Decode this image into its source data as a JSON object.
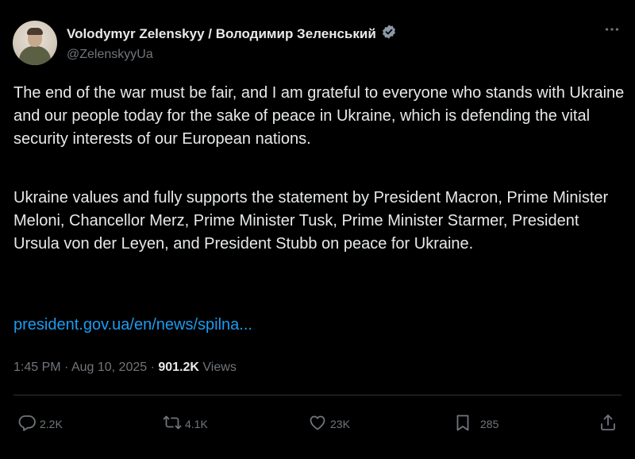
{
  "post": {
    "author_name": "Volodymyr Zelenskyy / Володимир Зеленський",
    "handle": "@ZelenskyyUa",
    "verified": true,
    "paragraph1": "The end of the war must be fair, and I am grateful to everyone who stands with Ukraine and our people today for the sake of peace in Ukraine, which is defending the vital security interests of our European nations.",
    "paragraph2": "Ukraine values and fully supports the statement by President Macron, Prime Minister Meloni, Chancellor Merz, Prime Minister Tusk, Prime Minister Starmer, President Ursula von der Leyen, and President Stubb on peace for Ukraine.",
    "link_text": "president.gov.ua/en/news/spilna...",
    "time": "1:45 PM",
    "date": "Aug 10, 2025",
    "views_count": "901.2K",
    "views_label": "Views",
    "separator": "·"
  },
  "actions": {
    "replies": "2.2K",
    "reposts": "4.1K",
    "likes": "23K",
    "bookmarks": "285"
  },
  "icons": {
    "verified": "verified-badge-icon",
    "more": "more-icon",
    "reply": "reply-icon",
    "repost": "repost-icon",
    "like": "heart-icon",
    "bookmark": "bookmark-icon",
    "share": "share-icon"
  },
  "colors": {
    "background": "#000000",
    "text": "#e7e9ea",
    "muted": "#71767b",
    "link": "#1d9bf0",
    "verified": "#8b98a5"
  }
}
